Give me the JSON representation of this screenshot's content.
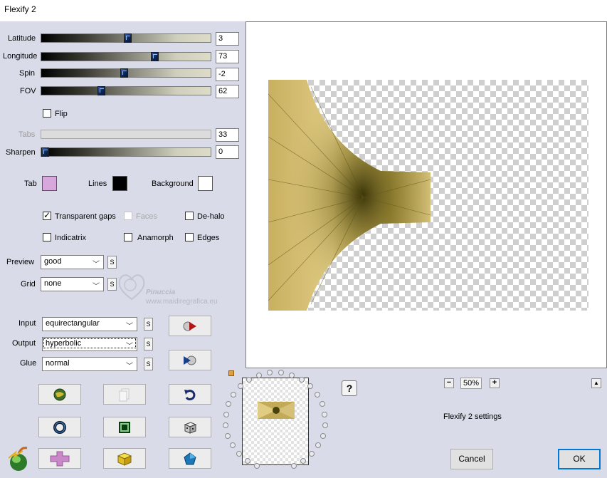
{
  "window": {
    "title": "Flexify 2"
  },
  "sliders": [
    {
      "label": "Latitude",
      "value": "3",
      "fraction": 0.51
    },
    {
      "label": "Longitude",
      "value": "73",
      "fraction": 0.68
    },
    {
      "label": "Spin",
      "value": "-2",
      "fraction": 0.49
    },
    {
      "label": "FOV",
      "value": "62",
      "fraction": 0.35
    },
    {
      "label": "Tabs",
      "value": "33",
      "disabled": true
    },
    {
      "label": "Sharpen",
      "value": "0",
      "fraction": 0.0
    }
  ],
  "flip": {
    "label": "Flip",
    "checked": false
  },
  "colors": {
    "tab": {
      "label": "Tab",
      "hex": "#d8a8dc"
    },
    "lines": {
      "label": "Lines",
      "hex": "#000000"
    },
    "background": {
      "label": "Background",
      "hex": "#ffffff"
    }
  },
  "options": {
    "transparent_gaps": {
      "label": "Transparent gaps",
      "checked": true
    },
    "faces": {
      "label": "Faces",
      "checked": false,
      "disabled": true
    },
    "de_halo": {
      "label": "De-halo",
      "checked": false
    },
    "indicatrix": {
      "label": "Indicatrix",
      "checked": false
    },
    "anamorph": {
      "label": "Anamorph",
      "checked": false
    },
    "edges": {
      "label": "Edges",
      "checked": false
    }
  },
  "preview": {
    "label": "Preview",
    "value": "good",
    "s": "S"
  },
  "grid": {
    "label": "Grid",
    "value": "none",
    "s": "S"
  },
  "input": {
    "label": "Input",
    "value": "equirectangular",
    "s": "S"
  },
  "output": {
    "label": "Output",
    "value": "hyperbolic",
    "s": "S"
  },
  "glue": {
    "label": "Glue",
    "value": "normal",
    "s": "S"
  },
  "watermark": {
    "name": "Pinuccia",
    "url": "www.maidiregrafica.eu"
  },
  "zoom": {
    "minus": "−",
    "value": "50%",
    "plus": "+"
  },
  "settings_label": "Flexify 2 settings",
  "help": "?",
  "collapse": "▲",
  "buttons": {
    "cancel": "Cancel",
    "ok": "OK"
  },
  "accent": "#0078d7",
  "icons": [
    "render-icon",
    "animate-icon",
    "globe-icon",
    "copy-icon",
    "undo-icon",
    "ring-icon",
    "square-icon",
    "dice-icon",
    "cross-icon",
    "cube-icon",
    "pentagon-icon",
    "apple-logo-icon"
  ]
}
